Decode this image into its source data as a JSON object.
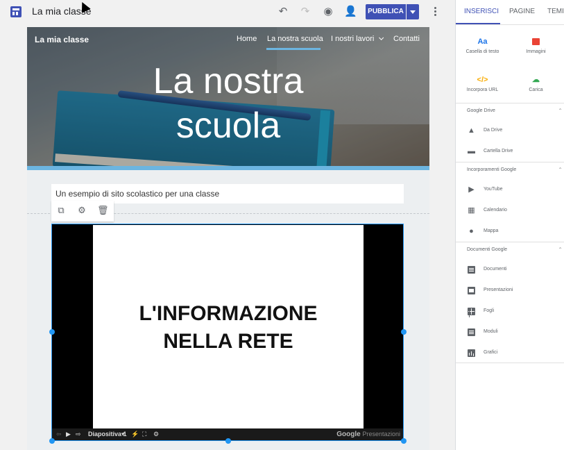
{
  "topbar": {
    "site_title": "La mia classe",
    "publish_label": "PUBBLICA"
  },
  "hero": {
    "site_name": "La mia classe",
    "nav": [
      "Home",
      "La nostra scuola",
      "I nostri lavori",
      "Contatti"
    ],
    "active_nav": "La nostra scuola",
    "title": "La nostra scuola"
  },
  "content": {
    "subtitle": "Un esempio di sito scolastico per una classe"
  },
  "embed": {
    "slide_text": "L'INFORMAZIONE NELLA RETE",
    "slide_selector": "Diapositiva 1",
    "brand": "Google",
    "brand_product": "Presentazioni"
  },
  "panel": {
    "tabs": [
      "INSERISCI",
      "PAGINE",
      "TEMI"
    ],
    "active_tab": "INSERISCI",
    "tiles": [
      {
        "icon": "text-box-icon",
        "label": "Casella di testo",
        "glyph": "Aa",
        "color": "#1a73e8"
      },
      {
        "icon": "image-icon",
        "label": "Immagini",
        "color": "#ea4335"
      },
      {
        "icon": "embed-icon",
        "label": "Incorpora URL",
        "glyph": "</>",
        "color": "#fbbc04"
      },
      {
        "icon": "upload-icon",
        "label": "Carica",
        "color": "#34a853"
      }
    ],
    "sections": [
      {
        "title": "Google Drive",
        "items": [
          "Da Drive",
          "Cartella Drive"
        ]
      },
      {
        "title": "Incorporamenti Google",
        "items": [
          "YouTube",
          "Calendario",
          "Mappa"
        ]
      },
      {
        "title": "Documenti Google",
        "items": [
          "Documenti",
          "Presentazioni",
          "Fogli",
          "Moduli",
          "Grafici"
        ]
      }
    ]
  }
}
